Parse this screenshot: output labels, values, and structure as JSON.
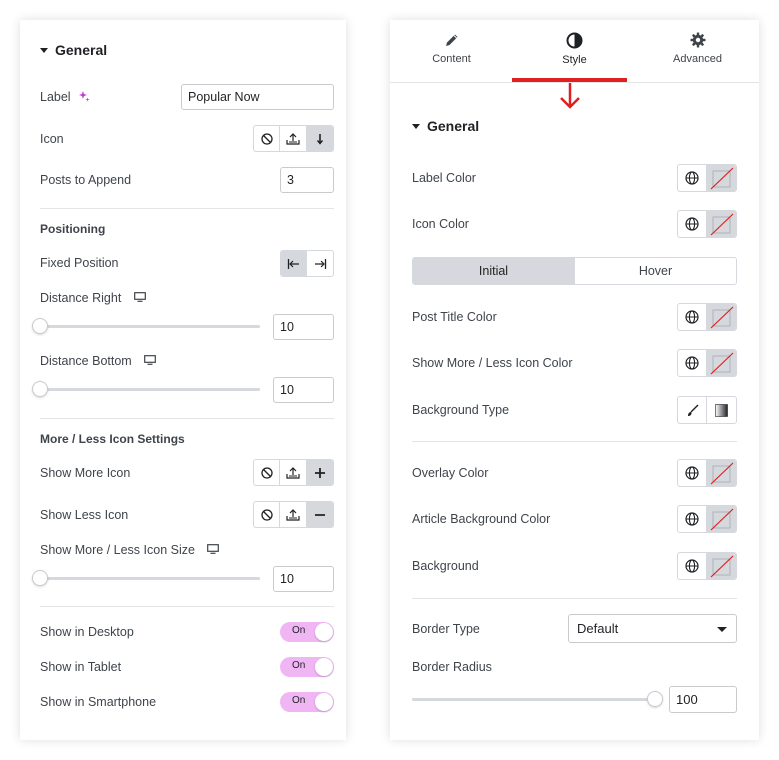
{
  "left_panel": {
    "general_title": "General",
    "label_row": {
      "label": "Label",
      "value": "Popular Now",
      "ai_icon": "sparkle-icon"
    },
    "icon_row": {
      "label": "Icon"
    },
    "posts_row": {
      "label": "Posts to Append",
      "value": "3"
    },
    "positioning_title": "Positioning",
    "fixed_position_label": "Fixed Position",
    "distance_right": {
      "label": "Distance Right",
      "value": "10",
      "slider_level": 0
    },
    "distance_bottom": {
      "label": "Distance Bottom",
      "value": "10",
      "slider_level": 0
    },
    "more_less_title": "More / Less Icon Settings",
    "show_more_icon_label": "Show More Icon",
    "show_less_icon_label": "Show Less Icon",
    "icon_size": {
      "label": "Show More / Less Icon Size",
      "value": "10",
      "slider_level": 0
    },
    "toggles": [
      {
        "label": "Show in Desktop",
        "state": "On"
      },
      {
        "label": "Show in Tablet",
        "state": "On"
      },
      {
        "label": "Show in Smartphone",
        "state": "On"
      }
    ]
  },
  "right_panel": {
    "tabs": [
      {
        "label": "Content",
        "icon": "pencil-icon"
      },
      {
        "label": "Style",
        "icon": "half-circle-icon"
      },
      {
        "label": "Advanced",
        "icon": "gear-icon"
      }
    ],
    "active_tab": "Style",
    "general_title": "General",
    "label_color": "Label Color",
    "icon_color": "Icon Color",
    "state_tabs": [
      "Initial",
      "Hover"
    ],
    "post_title_color": "Post Title Color",
    "show_more_less_icon_color": "Show More / Less Icon Color",
    "background_type": "Background Type",
    "overlay_color": "Overlay Color",
    "article_background_color": "Article Background Color",
    "background": "Background",
    "border_type": {
      "label": "Border Type",
      "value": "Default"
    },
    "border_radius": {
      "label": "Border Radius",
      "value": "100",
      "slider_level": 1
    }
  },
  "colors": {
    "accent_toggle": "#f0b6f4",
    "indicator_red": "#e02020",
    "ai_magenta": "#c036d6"
  }
}
